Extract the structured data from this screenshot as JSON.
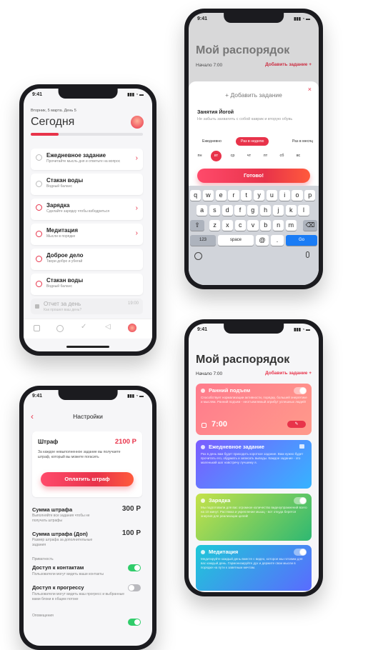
{
  "status_time": "9:41",
  "today": {
    "date": "Вторник, 5 марта. День 5",
    "title": "Сегодня",
    "tasks": [
      {
        "title": "Ежедневное задание",
        "subtitle": "Прочитайте мысль дня и ответьте на вопрос",
        "done": true
      },
      {
        "title": "Стакан воды",
        "subtitle": "Водный баланс",
        "done": true
      },
      {
        "title": "Зарядка",
        "subtitle": "Сделайте зарядку чтобы взбодриться",
        "done": false
      },
      {
        "title": "Медитация",
        "subtitle": "Мысли в порядке",
        "done": false
      },
      {
        "title": "Доброе дело",
        "subtitle": "Твори добро и убегай",
        "done": false
      },
      {
        "title": "Стакан воды",
        "subtitle": "Водный баланс",
        "done": false
      }
    ],
    "report": {
      "title": "Отчет за день",
      "subtitle": "Как прошел ваш день?",
      "time": "19:00"
    },
    "progress": 0.25
  },
  "settings": {
    "title": "Настройки",
    "fine": {
      "title": "Штраф",
      "amount": "2100 Р",
      "description": "За каждое невыполненное задание вы получаете штраф, который вы можете погасить",
      "button": "Оплатить штраф"
    },
    "fine_sum": {
      "title": "Сумма штрафа",
      "value": "300 Р",
      "description": "Выполняйте все задания чтобы не получать штрафы"
    },
    "fine_extra": {
      "title": "Сумма штрафа (Доп)",
      "value": "100 Р",
      "description": "Размер штрафа за дополнительные задания"
    },
    "privacy_header": "Приватность",
    "contacts": {
      "title": "Доступ к контактам",
      "description": "Пользователи могут видеть ваши контакты",
      "enabled": true
    },
    "progress_access": {
      "title": "Доступ к прогрессу",
      "description": "Пользователи могут видеть ваш прогресс и выбранные вами блоки в общем потоке",
      "enabled": false
    },
    "notifications_header": "Оповещения"
  },
  "schedule": {
    "title": "Мой распорядок",
    "start": "Начало 7:00",
    "add": "Добавить задание",
    "modal": {
      "title": "Добавить задание",
      "task_name": "Занятия Йогой",
      "task_note": "Не забыть захватить с собой каврик и вторую обувь",
      "freq": [
        "Ежедневно",
        "Раз в неделю",
        "Раз в месяц"
      ],
      "freq_selected": 1,
      "days": [
        "пн",
        "вт",
        "ср",
        "чт",
        "пт",
        "сб",
        "вс"
      ],
      "day_selected": 1,
      "done_button": "Готово!"
    },
    "keyboard": {
      "row1": [
        "q",
        "w",
        "e",
        "r",
        "t",
        "y",
        "u",
        "i",
        "o",
        "p"
      ],
      "row2": [
        "a",
        "s",
        "d",
        "f",
        "g",
        "h",
        "j",
        "k",
        "l"
      ],
      "row3": [
        "z",
        "x",
        "c",
        "v",
        "b",
        "n",
        "m"
      ],
      "num": "123",
      "space": "space",
      "at": "@",
      "dot": ".",
      "go": "Go"
    },
    "cards": [
      {
        "title": "Ранний подъем",
        "text": "Способствует нормализации активности, порядку, большей энергетике и мыслям. Ранний подъем - неотъемлемый атрибут успешных людей!",
        "time": "7:00",
        "enabled": true,
        "color_from": "#ff7b8c",
        "color_to": "#ff9a8b"
      },
      {
        "title": "Ежедневное задание",
        "text": "Раз в день вам будет приходить короткое задание. Вам нужно будет прочитать его, обдумать и записать выводы. Каждое задание - это маленький шаг навстречу лучшему я.",
        "locked": true,
        "color_from": "#7b5cff",
        "color_to": "#36b3ff"
      },
      {
        "title": "Зарядка",
        "text": "Мы подготовили для вас огромное количество видеоупражнений всего на 10 минут. Растяжка и укрепление мышц - вот откуда берется энергия для реализации целей!",
        "enabled": true,
        "color_from": "#c6e24a",
        "color_to": "#2eb872"
      },
      {
        "title": "Медитация",
        "text": "Медитируйте каждый день вместе с видео, которое мы готовим для вас каждый день. Гармонизируйте дух и держите свои мысли в порядке на пути к заветным мечтам.",
        "enabled": true,
        "color_from": "#1ec8d8",
        "color_to": "#5a6bff"
      }
    ]
  },
  "colors": {
    "accent": "#e8334a"
  }
}
